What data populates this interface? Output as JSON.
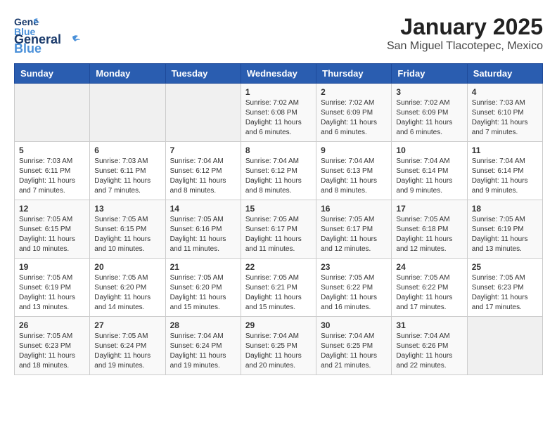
{
  "header": {
    "logo_general": "General",
    "logo_blue": "Blue",
    "title": "January 2025",
    "subtitle": "San Miguel Tlacotepec, Mexico"
  },
  "weekdays": [
    "Sunday",
    "Monday",
    "Tuesday",
    "Wednesday",
    "Thursday",
    "Friday",
    "Saturday"
  ],
  "weeks": [
    [
      {
        "day": "",
        "info": ""
      },
      {
        "day": "",
        "info": ""
      },
      {
        "day": "",
        "info": ""
      },
      {
        "day": "1",
        "info": "Sunrise: 7:02 AM\nSunset: 6:08 PM\nDaylight: 11 hours and 6 minutes."
      },
      {
        "day": "2",
        "info": "Sunrise: 7:02 AM\nSunset: 6:09 PM\nDaylight: 11 hours and 6 minutes."
      },
      {
        "day": "3",
        "info": "Sunrise: 7:02 AM\nSunset: 6:09 PM\nDaylight: 11 hours and 6 minutes."
      },
      {
        "day": "4",
        "info": "Sunrise: 7:03 AM\nSunset: 6:10 PM\nDaylight: 11 hours and 7 minutes."
      }
    ],
    [
      {
        "day": "5",
        "info": "Sunrise: 7:03 AM\nSunset: 6:11 PM\nDaylight: 11 hours and 7 minutes."
      },
      {
        "day": "6",
        "info": "Sunrise: 7:03 AM\nSunset: 6:11 PM\nDaylight: 11 hours and 7 minutes."
      },
      {
        "day": "7",
        "info": "Sunrise: 7:04 AM\nSunset: 6:12 PM\nDaylight: 11 hours and 8 minutes."
      },
      {
        "day": "8",
        "info": "Sunrise: 7:04 AM\nSunset: 6:12 PM\nDaylight: 11 hours and 8 minutes."
      },
      {
        "day": "9",
        "info": "Sunrise: 7:04 AM\nSunset: 6:13 PM\nDaylight: 11 hours and 8 minutes."
      },
      {
        "day": "10",
        "info": "Sunrise: 7:04 AM\nSunset: 6:14 PM\nDaylight: 11 hours and 9 minutes."
      },
      {
        "day": "11",
        "info": "Sunrise: 7:04 AM\nSunset: 6:14 PM\nDaylight: 11 hours and 9 minutes."
      }
    ],
    [
      {
        "day": "12",
        "info": "Sunrise: 7:05 AM\nSunset: 6:15 PM\nDaylight: 11 hours and 10 minutes."
      },
      {
        "day": "13",
        "info": "Sunrise: 7:05 AM\nSunset: 6:15 PM\nDaylight: 11 hours and 10 minutes."
      },
      {
        "day": "14",
        "info": "Sunrise: 7:05 AM\nSunset: 6:16 PM\nDaylight: 11 hours and 11 minutes."
      },
      {
        "day": "15",
        "info": "Sunrise: 7:05 AM\nSunset: 6:17 PM\nDaylight: 11 hours and 11 minutes."
      },
      {
        "day": "16",
        "info": "Sunrise: 7:05 AM\nSunset: 6:17 PM\nDaylight: 11 hours and 12 minutes."
      },
      {
        "day": "17",
        "info": "Sunrise: 7:05 AM\nSunset: 6:18 PM\nDaylight: 11 hours and 12 minutes."
      },
      {
        "day": "18",
        "info": "Sunrise: 7:05 AM\nSunset: 6:19 PM\nDaylight: 11 hours and 13 minutes."
      }
    ],
    [
      {
        "day": "19",
        "info": "Sunrise: 7:05 AM\nSunset: 6:19 PM\nDaylight: 11 hours and 13 minutes."
      },
      {
        "day": "20",
        "info": "Sunrise: 7:05 AM\nSunset: 6:20 PM\nDaylight: 11 hours and 14 minutes."
      },
      {
        "day": "21",
        "info": "Sunrise: 7:05 AM\nSunset: 6:20 PM\nDaylight: 11 hours and 15 minutes."
      },
      {
        "day": "22",
        "info": "Sunrise: 7:05 AM\nSunset: 6:21 PM\nDaylight: 11 hours and 15 minutes."
      },
      {
        "day": "23",
        "info": "Sunrise: 7:05 AM\nSunset: 6:22 PM\nDaylight: 11 hours and 16 minutes."
      },
      {
        "day": "24",
        "info": "Sunrise: 7:05 AM\nSunset: 6:22 PM\nDaylight: 11 hours and 17 minutes."
      },
      {
        "day": "25",
        "info": "Sunrise: 7:05 AM\nSunset: 6:23 PM\nDaylight: 11 hours and 17 minutes."
      }
    ],
    [
      {
        "day": "26",
        "info": "Sunrise: 7:05 AM\nSunset: 6:23 PM\nDaylight: 11 hours and 18 minutes."
      },
      {
        "day": "27",
        "info": "Sunrise: 7:05 AM\nSunset: 6:24 PM\nDaylight: 11 hours and 19 minutes."
      },
      {
        "day": "28",
        "info": "Sunrise: 7:04 AM\nSunset: 6:24 PM\nDaylight: 11 hours and 19 minutes."
      },
      {
        "day": "29",
        "info": "Sunrise: 7:04 AM\nSunset: 6:25 PM\nDaylight: 11 hours and 20 minutes."
      },
      {
        "day": "30",
        "info": "Sunrise: 7:04 AM\nSunset: 6:25 PM\nDaylight: 11 hours and 21 minutes."
      },
      {
        "day": "31",
        "info": "Sunrise: 7:04 AM\nSunset: 6:26 PM\nDaylight: 11 hours and 22 minutes."
      },
      {
        "day": "",
        "info": ""
      }
    ]
  ]
}
